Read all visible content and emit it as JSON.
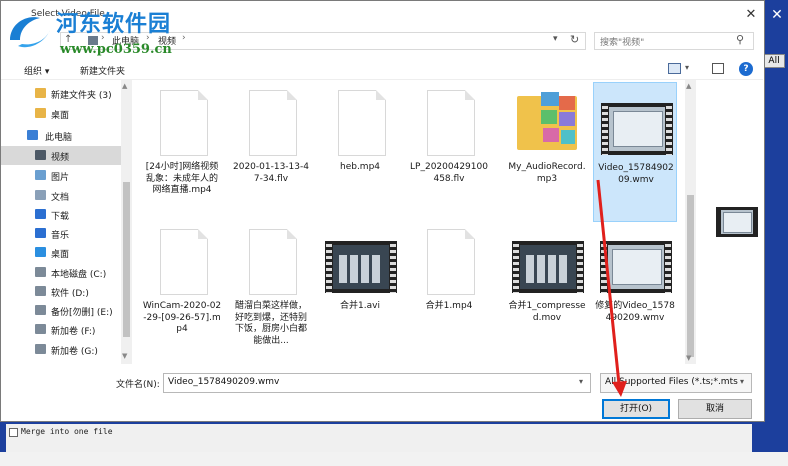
{
  "dialog": {
    "title": "Select Video File",
    "close_glyph": "✕"
  },
  "watermark": {
    "title": "河东软件园",
    "url": "www.pc0359.cn"
  },
  "address_bar": {
    "up_glyph": "↑",
    "crumbs": [
      "此电脑",
      "视频"
    ],
    "refresh_glyph": "↻"
  },
  "search": {
    "placeholder": "搜索\"视频\"",
    "icon_glyph": "⚲"
  },
  "toolbar": {
    "organize_label": "组织 ▾",
    "new_folder_label": "新建文件夹",
    "help_glyph": "?"
  },
  "nav": {
    "items": [
      {
        "label": "新建文件夹 (3)",
        "icon": "folder-icon",
        "color": "#e8b447"
      },
      {
        "label": "桌面",
        "icon": "folder-icon",
        "color": "#e8b447"
      },
      {
        "label": "此电脑",
        "icon": "computer-icon",
        "color": "#3a7fd5"
      },
      {
        "label": "视频",
        "icon": "video-folder-icon",
        "color": "#4d5966"
      },
      {
        "label": "图片",
        "icon": "pictures-icon",
        "color": "#6a9fd0"
      },
      {
        "label": "文档",
        "icon": "documents-icon",
        "color": "#8aa0b8"
      },
      {
        "label": "下载",
        "icon": "download-icon",
        "color": "#2b6fd1"
      },
      {
        "label": "音乐",
        "icon": "music-icon",
        "color": "#2b6fd1"
      },
      {
        "label": "桌面",
        "icon": "desktop-icon",
        "color": "#2b8fe0"
      },
      {
        "label": "本地磁盘 (C:)",
        "icon": "drive-icon",
        "color": "#7c8a98"
      },
      {
        "label": "软件 (D:)",
        "icon": "drive-icon",
        "color": "#7c8a98"
      },
      {
        "label": "备份[勿删] (E:)",
        "icon": "drive-icon",
        "color": "#7c8a98"
      },
      {
        "label": "新加卷 (F:)",
        "icon": "drive-icon",
        "color": "#7c8a98"
      },
      {
        "label": "新加卷 (G:)",
        "icon": "drive-icon",
        "color": "#7c8a98"
      }
    ]
  },
  "files": [
    {
      "name": "[24小时]网络视频乱象：未成年人的网络直播.mp4",
      "type": "doc"
    },
    {
      "name": "2020-01-13-13-47-34.flv",
      "type": "doc"
    },
    {
      "name": "heb.mp4",
      "type": "doc"
    },
    {
      "name": "LP_20200429100458.flv",
      "type": "doc"
    },
    {
      "name": "My_AudioRecord.mp3",
      "type": "folder"
    },
    {
      "name": "Video_1578490209.wmv",
      "type": "video-win",
      "selected": true
    },
    {
      "name": "WinCam-2020-02-29-[09-26-57].mp4",
      "type": "doc"
    },
    {
      "name": "醋溜白菜这样做，好吃到爆，还特别下饭，厨房小白都能做出...",
      "type": "doc"
    },
    {
      "name": "合并1.avi",
      "type": "video-keys"
    },
    {
      "name": "合并1.mp4",
      "type": "doc"
    },
    {
      "name": "合并1_compressed.mov",
      "type": "video-keys"
    },
    {
      "name": "修复的Video_1578490209.wmv",
      "type": "video-win"
    }
  ],
  "footer": {
    "filename_label": "文件名(N):",
    "filename_value": "Video_1578490209.wmv",
    "filter_value": "All Supported Files (*.ts;*.mts",
    "open_label": "打开(O)",
    "cancel_label": "取消"
  },
  "background": {
    "side_button": "All",
    "checkbox_label": "Merge into one file"
  },
  "colors": {
    "selection": "#cce6fb",
    "arrow": "#e0201c",
    "accent": "#0078d7"
  }
}
